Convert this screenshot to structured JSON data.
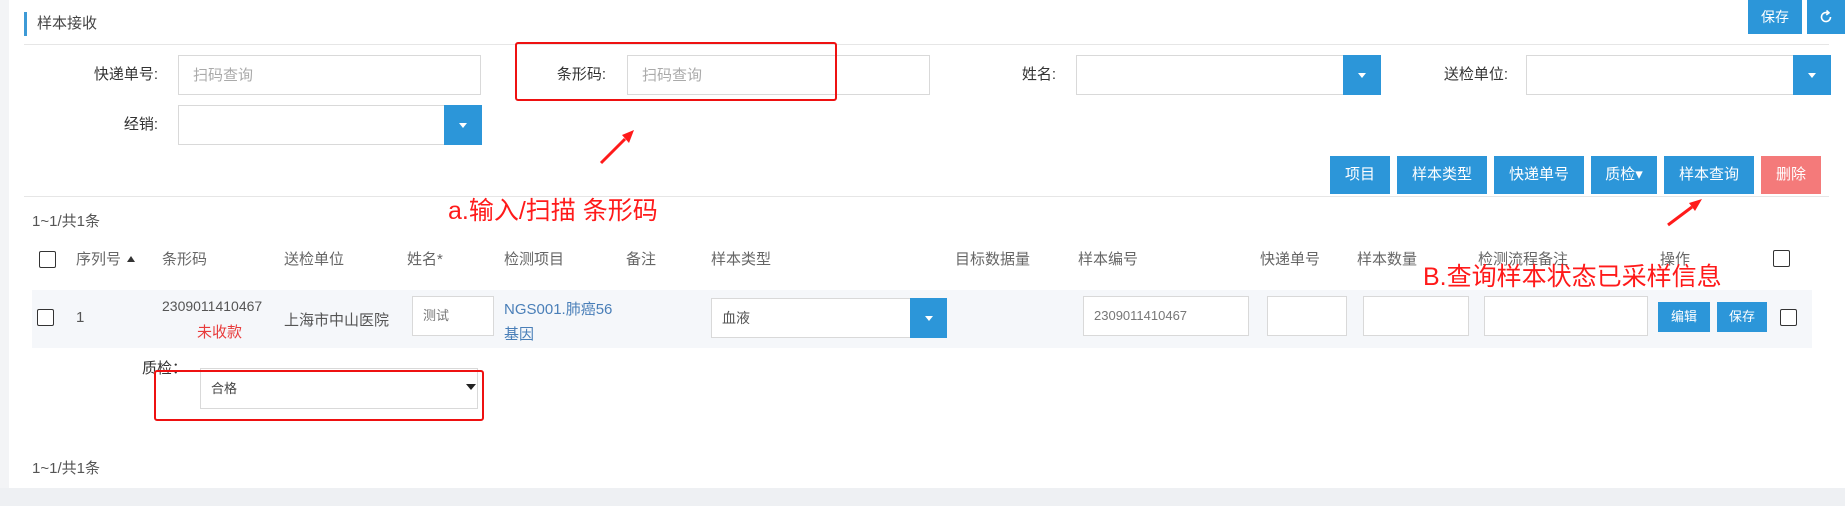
{
  "header": {
    "title": "样本接收",
    "save_button": "保存"
  },
  "filters": {
    "express_label": "快递单号:",
    "express_placeholder": "扫码查询",
    "barcode_label": "条形码:",
    "barcode_placeholder": "扫码查询",
    "name_label": "姓名:",
    "unit_label": "送检单位:",
    "dealer_label": "经销:"
  },
  "actions": {
    "project": "项目",
    "sample_type": "样本类型",
    "express": "快递单号",
    "qc": "质检▾",
    "sample_query": "样本查询",
    "delete": "删除"
  },
  "pagination": {
    "top": "1~1/共1条",
    "bottom": "1~1/共1条"
  },
  "table": {
    "headers": [
      "序列号",
      "条形码",
      "送检单位",
      "姓名*",
      "检测项目",
      "备注",
      "样本类型",
      "目标数据量",
      "样本编号",
      "快递单号",
      "样本数量",
      "检测流程备注",
      "操作"
    ],
    "rows": [
      {
        "seq": "1",
        "barcode": "2309011410467",
        "payment_status": "未收款",
        "unit": "上海市中山医院",
        "name": "测试",
        "project_line1": "NGS001.肺癌56",
        "project_line2": "基因",
        "sample_type": "血液",
        "sample_no": "2309011410467",
        "edit_button": "编辑",
        "save_button": "保存"
      }
    ],
    "qc_label": "质检：",
    "qc_value": "合格"
  },
  "annotations": {
    "a": "a.输入/扫描 条形码",
    "b": "B.查询样本状态已采样信息",
    "color": "#ff1a1a"
  },
  "colors": {
    "primary": "#2c96d9",
    "danger": "#f47a7a",
    "link": "#4a7fb8",
    "warning_text": "#e83b3b"
  }
}
